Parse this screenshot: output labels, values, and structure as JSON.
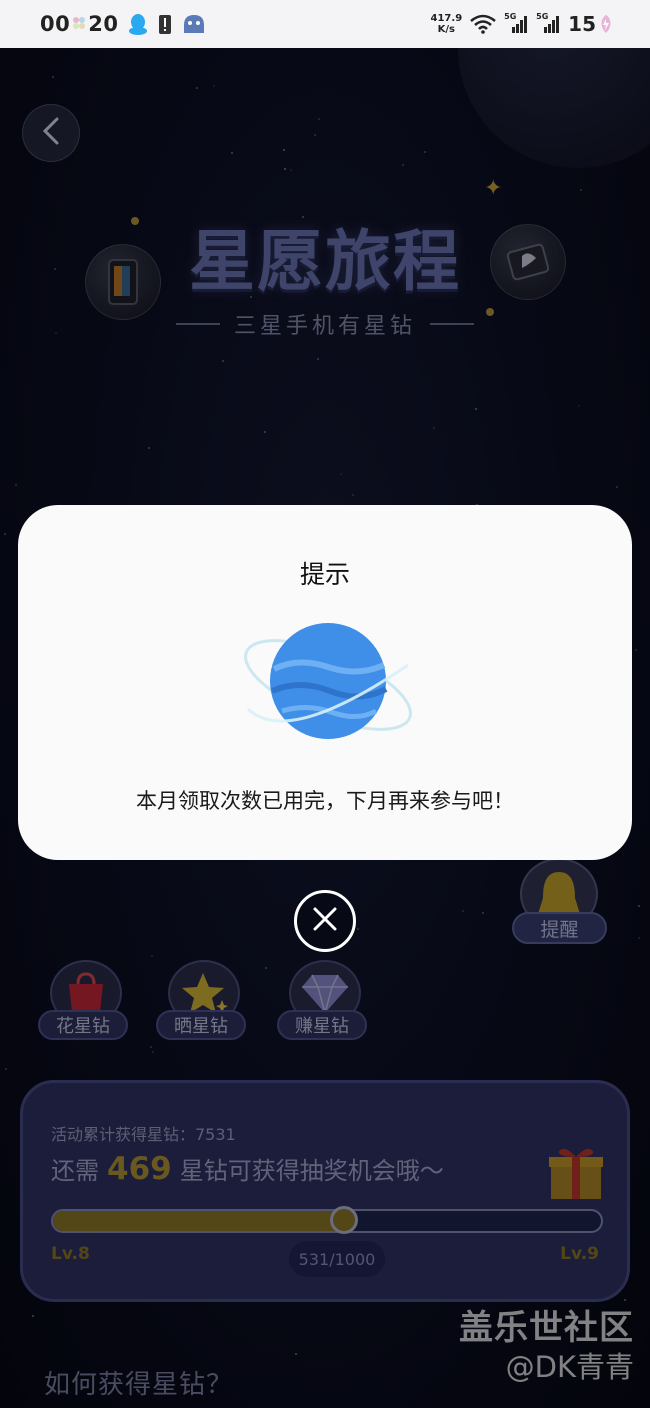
{
  "status_bar": {
    "time": "00",
    "time_minutes": "20",
    "net_speed_value": "417.9",
    "net_speed_unit": "K/s",
    "sim1": "5G",
    "sim2": "5G",
    "battery": "15",
    "icons": [
      "pinwheel-icon",
      "qq-penguin-icon",
      "alert-icon",
      "bot-face-icon",
      "wifi-icon",
      "signal-icon",
      "signal-icon",
      "battery-icon"
    ]
  },
  "header": {
    "title": "星愿旅程",
    "subtitle": "三星手机有星钻"
  },
  "remind": {
    "label": "提醒"
  },
  "features": [
    {
      "label": "花星钻",
      "icon": "shopping-bag-icon"
    },
    {
      "label": "晒星钻",
      "icon": "star-icon"
    },
    {
      "label": "赚星钻",
      "icon": "diamond-icon"
    }
  ],
  "progress_panel": {
    "cumulative_label": "活动累计获得星钻：7531",
    "need_prefix": "还需",
    "need_number": "469",
    "need_suffix": "星钻可获得抽奖机会哦～",
    "level_from": "Lv.8",
    "level_to": "Lv.9",
    "progress_text": "531/1000",
    "progress_fraction": 0.531
  },
  "how_to": "如何获得星钻？",
  "watermark": {
    "line1": "盖乐世社区",
    "line2": "@DK青青"
  },
  "dialog": {
    "title": "提示",
    "message": "本月领取次数已用完，下月再来参与吧！"
  },
  "colors": {
    "accent_gold": "#8f7a28",
    "panel_bg": "#2f3366",
    "dialog_bg": "#fafafa",
    "planet_blue": "#3f8fe8"
  }
}
